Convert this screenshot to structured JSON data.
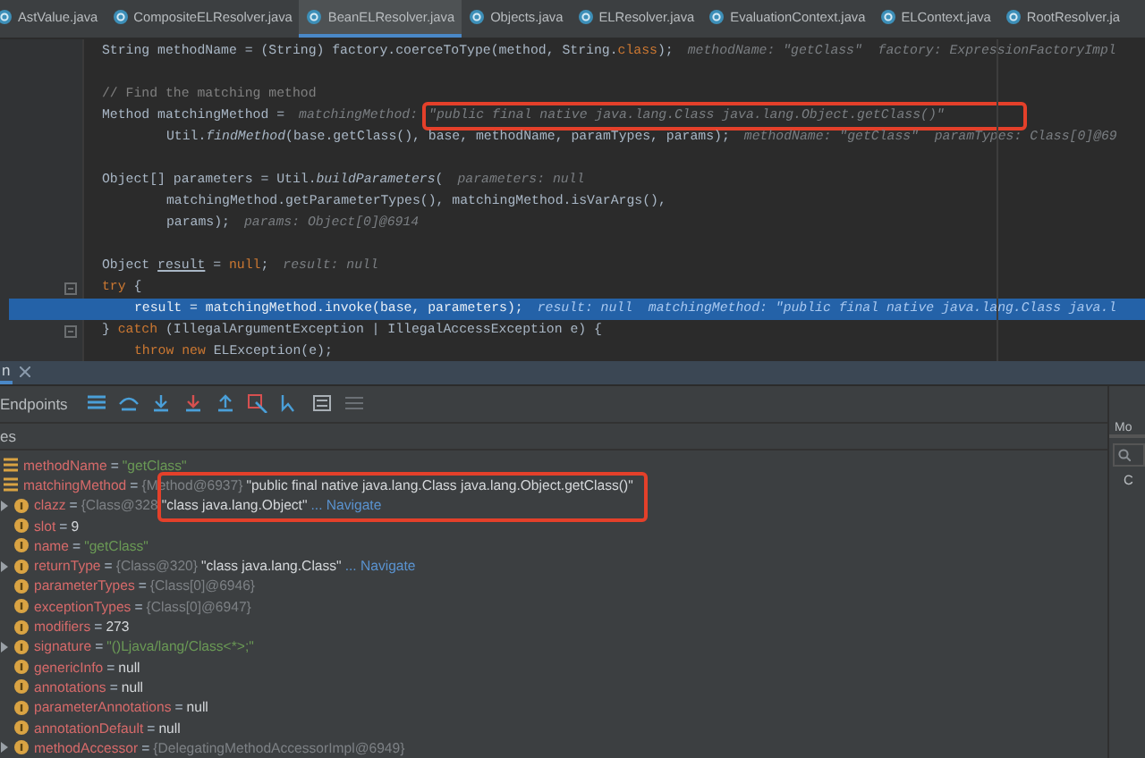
{
  "tabs": [
    {
      "label": "AstValue.java",
      "selected": false
    },
    {
      "label": "CompositeELResolver.java",
      "selected": false
    },
    {
      "label": "BeanELResolver.java",
      "selected": true
    },
    {
      "label": "Objects.java",
      "selected": false
    },
    {
      "label": "ELResolver.java",
      "selected": false
    },
    {
      "label": "EvaluationContext.java",
      "selected": false
    },
    {
      "label": "ELContext.java",
      "selected": false
    },
    {
      "label": "RootResolver.ja",
      "selected": false
    }
  ],
  "code": [
    {
      "kind": "statement",
      "segments": [
        {
          "t": "String methodName = (String) factory.coerceToType(method, String.",
          "kind": "plain"
        },
        {
          "t": "class",
          "kind": "keyword"
        },
        {
          "t": ");",
          "kind": "plain"
        }
      ],
      "hint": "methodName: \"getClass\"  factory: ExpressionFactoryImpl"
    },
    {
      "kind": "blank"
    },
    {
      "kind": "statement",
      "segments": [
        {
          "t": "// Find the matching method",
          "kind": "comment"
        }
      ]
    },
    {
      "kind": "statement",
      "segments": [
        {
          "t": "Method matchingMethod =",
          "kind": "plain"
        }
      ],
      "hint": "matchingMethod:",
      "hint_value": "\"public final native java.lang.Class java.lang.Object.getClass()\"",
      "highlighted": true
    },
    {
      "kind": "continuation",
      "segments": [
        {
          "t": "Util.",
          "kind": "plain"
        },
        {
          "t": "findMethod",
          "kind": "italic"
        },
        {
          "t": "(base.getClass(), base, methodName, paramTypes, params);",
          "kind": "plain"
        }
      ],
      "hint": "methodName: \"getClass\"  paramTypes: Class[0]@69"
    },
    {
      "kind": "blank"
    },
    {
      "kind": "statement",
      "segments": [
        {
          "t": "Object[] parameters = Util.",
          "kind": "plain"
        },
        {
          "t": "buildParameters",
          "kind": "italic"
        },
        {
          "t": "(",
          "kind": "plain"
        }
      ],
      "hint": "parameters: null"
    },
    {
      "kind": "continuation",
      "segments": [
        {
          "t": "matchingMethod.getParameterTypes(), matchingMethod.isVarArgs(),",
          "kind": "plain"
        }
      ]
    },
    {
      "kind": "continuation",
      "segments": [
        {
          "t": "params);",
          "kind": "plain"
        }
      ],
      "hint": "params: Object[0]@6914"
    },
    {
      "kind": "blank"
    },
    {
      "kind": "statement",
      "segments": [
        {
          "t": "Object ",
          "kind": "plain"
        },
        {
          "t": "result",
          "kind": "underline"
        },
        {
          "t": " = ",
          "kind": "plain"
        },
        {
          "t": "null",
          "kind": "keyword"
        },
        {
          "t": ";",
          "kind": "plain"
        }
      ],
      "hint": "result: null"
    },
    {
      "kind": "statement",
      "fold": true,
      "segments": [
        {
          "t": "try",
          "kind": "keyword"
        },
        {
          "t": " {",
          "kind": "plain"
        }
      ]
    },
    {
      "kind": "current",
      "segments": [
        {
          "t": "result = matchingMethod.invoke(base, parameters);",
          "kind": "plain"
        }
      ],
      "hint": "result: null  matchingMethod: \"public final native java.lang.Class java.l"
    },
    {
      "kind": "statement",
      "fold": true,
      "segments": [
        {
          "t": "} ",
          "kind": "plain"
        },
        {
          "t": "catch",
          "kind": "keyword"
        },
        {
          "t": " (IllegalArgumentException | IllegalAccessException e) {",
          "kind": "plain"
        }
      ]
    },
    {
      "kind": "body",
      "segments": [
        {
          "t": "throw new",
          "kind": "keyword"
        },
        {
          "t": " ELException(e);",
          "kind": "plain"
        }
      ]
    }
  ],
  "debug_tab": {
    "label": "n"
  },
  "toolbar": {
    "label": "Endpoints"
  },
  "variables_header": "es",
  "variables": [
    {
      "name": "methodName",
      "kind": "local",
      "equals": "=",
      "value": "\"getClass\"",
      "literal": true
    },
    {
      "name": "matchingMethod",
      "kind": "local",
      "highlighted": true,
      "equals": "=",
      "ref": "{Method@6937}",
      "value": "\"public final native java.lang.Class java.lang.Object.getClass()\"",
      "literal": false,
      "children": [
        {
          "name": "clazz",
          "kind": "field",
          "equals": "=",
          "expanded": false,
          "ref": "{Class@328",
          "value": "\"class java.lang.Object\"",
          "literal": false,
          "navigate": "... Navigate"
        },
        {
          "name": "slot",
          "kind": "field",
          "equals": "=",
          "value": "9",
          "literal": false
        },
        {
          "name": "name",
          "kind": "field",
          "equals": "=",
          "value": "\"getClass\"",
          "literal": true
        },
        {
          "name": "returnType",
          "kind": "field",
          "equals": "=",
          "expanded": false,
          "ref": "{Class@320}",
          "value": "\"class java.lang.Class\"",
          "literal": false,
          "navigate": "... Navigate"
        },
        {
          "name": "parameterTypes",
          "kind": "field",
          "equals": "=",
          "ref": "{Class[0]@6946}"
        },
        {
          "name": "exceptionTypes",
          "kind": "field",
          "equals": "=",
          "ref": "{Class[0]@6947}"
        },
        {
          "name": "modifiers",
          "kind": "field",
          "equals": "=",
          "value": "273",
          "literal": false
        },
        {
          "name": "signature",
          "kind": "field",
          "equals": "=",
          "expanded": false,
          "value": "\"()Ljava/lang/Class<*>;\"",
          "literal": true
        },
        {
          "name": "genericInfo",
          "kind": "field",
          "equals": "=",
          "value": "null",
          "literal": false
        },
        {
          "name": "annotations",
          "kind": "field",
          "equals": "=",
          "value": "null",
          "literal": false
        },
        {
          "name": "parameterAnnotations",
          "kind": "field",
          "equals": "=",
          "value": "null",
          "literal": false
        },
        {
          "name": "annotationDefault",
          "kind": "field",
          "equals": "=",
          "value": "null",
          "literal": false
        },
        {
          "name": "methodAccessor",
          "kind": "field",
          "equals": "=",
          "expanded": false,
          "ref": "{DelegatingMethodAccessorImpl@6949}"
        }
      ]
    }
  ],
  "side_panel": {
    "tab": "Mo",
    "item": "C"
  }
}
